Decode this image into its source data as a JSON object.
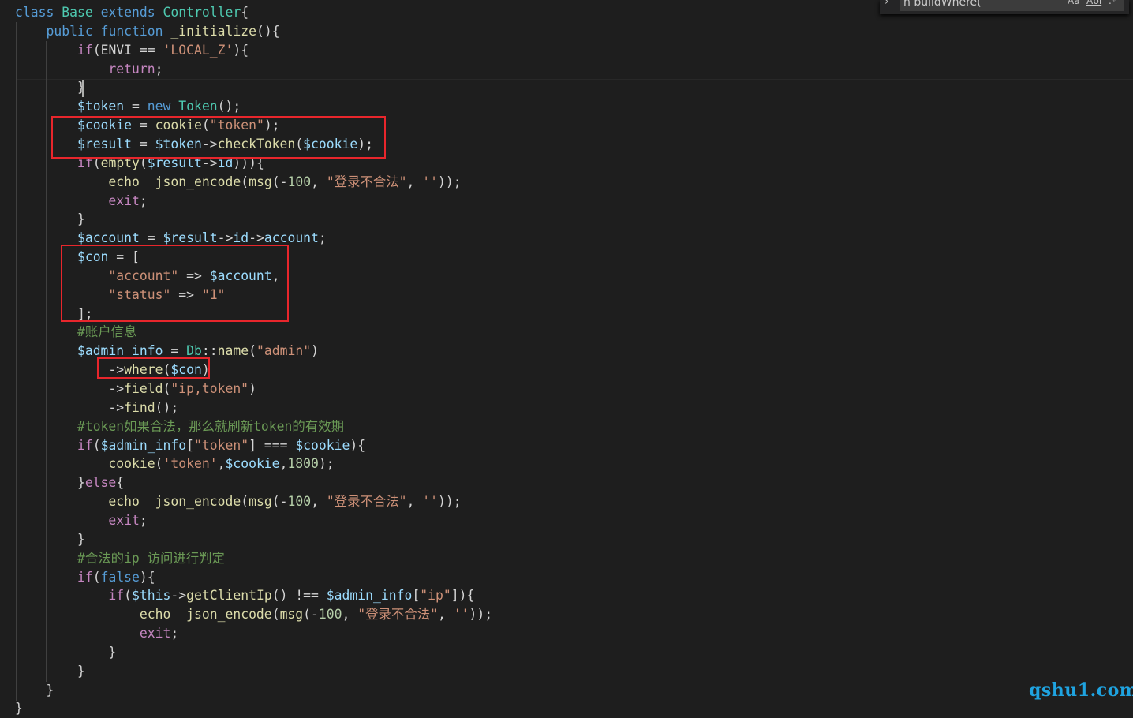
{
  "find_widget": {
    "toggle_icon": "chevron-right-icon",
    "query": "n buildWhere(",
    "match_case_label": "Aa",
    "whole_word_label": "Abl",
    "regex_label": ".*"
  },
  "code": {
    "lines": [
      [
        [
          "kw",
          "class"
        ],
        [
          "pl",
          " "
        ],
        [
          "cls",
          "Base"
        ],
        [
          "pl",
          " "
        ],
        [
          "kw",
          "extends"
        ],
        [
          "pl",
          " "
        ],
        [
          "cls",
          "Controller"
        ],
        [
          "pl",
          "{"
        ]
      ],
      [
        [
          "pl",
          "    "
        ],
        [
          "kw",
          "public"
        ],
        [
          "pl",
          " "
        ],
        [
          "kw",
          "function"
        ],
        [
          "pl",
          " "
        ],
        [
          "fn",
          "_initialize"
        ],
        [
          "pl",
          "(){"
        ]
      ],
      [
        [
          "pl",
          "        "
        ],
        [
          "ctl",
          "if"
        ],
        [
          "pl",
          "(ENVI == "
        ],
        [
          "str",
          "'LOCAL_Z'"
        ],
        [
          "pl",
          "){"
        ]
      ],
      [
        [
          "pl",
          "            "
        ],
        [
          "ctl",
          "return"
        ],
        [
          "pl",
          ";"
        ]
      ],
      [
        [
          "pl",
          "        }"
        ]
      ],
      [
        [
          "pl",
          "        "
        ],
        [
          "var",
          "$token"
        ],
        [
          "pl",
          " = "
        ],
        [
          "kw",
          "new"
        ],
        [
          "pl",
          " "
        ],
        [
          "cls",
          "Token"
        ],
        [
          "pl",
          "();"
        ]
      ],
      [
        [
          "pl",
          "        "
        ],
        [
          "var",
          "$cookie"
        ],
        [
          "pl",
          " = "
        ],
        [
          "fn",
          "cookie"
        ],
        [
          "pl",
          "("
        ],
        [
          "str",
          "\"token\""
        ],
        [
          "pl",
          ");"
        ]
      ],
      [
        [
          "pl",
          "        "
        ],
        [
          "var",
          "$result"
        ],
        [
          "pl",
          " = "
        ],
        [
          "var",
          "$token"
        ],
        [
          "pl",
          "->"
        ],
        [
          "fn",
          "checkToken"
        ],
        [
          "pl",
          "("
        ],
        [
          "var",
          "$cookie"
        ],
        [
          "pl",
          ");"
        ]
      ],
      [
        [
          "pl",
          "        "
        ],
        [
          "ctl",
          "if"
        ],
        [
          "pl",
          "("
        ],
        [
          "fn",
          "empty"
        ],
        [
          "pl",
          "("
        ],
        [
          "var",
          "$result"
        ],
        [
          "pl",
          "->"
        ],
        [
          "var",
          "id"
        ],
        [
          "pl",
          "))){"
        ]
      ],
      [
        [
          "pl",
          "            "
        ],
        [
          "fn",
          "echo"
        ],
        [
          "pl",
          "  "
        ],
        [
          "fn",
          "json_encode"
        ],
        [
          "pl",
          "("
        ],
        [
          "fn",
          "msg"
        ],
        [
          "pl",
          "(-"
        ],
        [
          "num",
          "100"
        ],
        [
          "pl",
          ", "
        ],
        [
          "str",
          "\"登录不合法\""
        ],
        [
          "pl",
          ", "
        ],
        [
          "str",
          "''"
        ],
        [
          "pl",
          "));"
        ]
      ],
      [
        [
          "pl",
          "            "
        ],
        [
          "ctl",
          "exit"
        ],
        [
          "pl",
          ";"
        ]
      ],
      [
        [
          "pl",
          "        }"
        ]
      ],
      [
        [
          "pl",
          "        "
        ],
        [
          "var",
          "$account"
        ],
        [
          "pl",
          " = "
        ],
        [
          "var",
          "$result"
        ],
        [
          "pl",
          "->"
        ],
        [
          "var",
          "id"
        ],
        [
          "pl",
          "->"
        ],
        [
          "var",
          "account"
        ],
        [
          "pl",
          ";"
        ]
      ],
      [
        [
          "pl",
          "        "
        ],
        [
          "var",
          "$con"
        ],
        [
          "pl",
          " = ["
        ]
      ],
      [
        [
          "pl",
          "            "
        ],
        [
          "str",
          "\"account\""
        ],
        [
          "pl",
          " => "
        ],
        [
          "var",
          "$account"
        ],
        [
          "pl",
          ","
        ]
      ],
      [
        [
          "pl",
          "            "
        ],
        [
          "str",
          "\"status\""
        ],
        [
          "pl",
          " => "
        ],
        [
          "str",
          "\"1\""
        ]
      ],
      [
        [
          "pl",
          "        ];"
        ]
      ],
      [
        [
          "pl",
          "        "
        ],
        [
          "cmt",
          "#账户信息"
        ]
      ],
      [
        [
          "pl",
          "        "
        ],
        [
          "var",
          "$admin_info"
        ],
        [
          "pl",
          " = "
        ],
        [
          "cls",
          "Db"
        ],
        [
          "pl",
          "::"
        ],
        [
          "fn",
          "name"
        ],
        [
          "pl",
          "("
        ],
        [
          "str",
          "\"admin\""
        ],
        [
          "pl",
          ")"
        ]
      ],
      [
        [
          "pl",
          "            ->"
        ],
        [
          "fn",
          "where"
        ],
        [
          "pl",
          "("
        ],
        [
          "var",
          "$con"
        ],
        [
          "pl",
          ")"
        ]
      ],
      [
        [
          "pl",
          "            ->"
        ],
        [
          "fn",
          "field"
        ],
        [
          "pl",
          "("
        ],
        [
          "str",
          "\"ip,token\""
        ],
        [
          "pl",
          ")"
        ]
      ],
      [
        [
          "pl",
          "            ->"
        ],
        [
          "fn",
          "find"
        ],
        [
          "pl",
          "();"
        ]
      ],
      [
        [
          "pl",
          "        "
        ],
        [
          "cmt",
          "#token如果合法，那么就刷新token的有效期"
        ]
      ],
      [
        [
          "pl",
          "        "
        ],
        [
          "ctl",
          "if"
        ],
        [
          "pl",
          "("
        ],
        [
          "var",
          "$admin_info"
        ],
        [
          "pl",
          "["
        ],
        [
          "str",
          "\"token\""
        ],
        [
          "pl",
          "] === "
        ],
        [
          "var",
          "$cookie"
        ],
        [
          "pl",
          "){"
        ]
      ],
      [
        [
          "pl",
          "            "
        ],
        [
          "fn",
          "cookie"
        ],
        [
          "pl",
          "("
        ],
        [
          "str",
          "'token'"
        ],
        [
          "pl",
          ","
        ],
        [
          "var",
          "$cookie"
        ],
        [
          "pl",
          ","
        ],
        [
          "num",
          "1800"
        ],
        [
          "pl",
          ");"
        ]
      ],
      [
        [
          "pl",
          "        }"
        ],
        [
          "ctl",
          "else"
        ],
        [
          "pl",
          "{"
        ]
      ],
      [
        [
          "pl",
          "            "
        ],
        [
          "fn",
          "echo"
        ],
        [
          "pl",
          "  "
        ],
        [
          "fn",
          "json_encode"
        ],
        [
          "pl",
          "("
        ],
        [
          "fn",
          "msg"
        ],
        [
          "pl",
          "(-"
        ],
        [
          "num",
          "100"
        ],
        [
          "pl",
          ", "
        ],
        [
          "str",
          "\"登录不合法\""
        ],
        [
          "pl",
          ", "
        ],
        [
          "str",
          "''"
        ],
        [
          "pl",
          "));"
        ]
      ],
      [
        [
          "pl",
          "            "
        ],
        [
          "ctl",
          "exit"
        ],
        [
          "pl",
          ";"
        ]
      ],
      [
        [
          "pl",
          "        }"
        ]
      ],
      [
        [
          "pl",
          "        "
        ],
        [
          "cmt",
          "#合法的ip 访问进行判定"
        ]
      ],
      [
        [
          "pl",
          "        "
        ],
        [
          "ctl",
          "if"
        ],
        [
          "pl",
          "("
        ],
        [
          "kw",
          "false"
        ],
        [
          "pl",
          "){"
        ]
      ],
      [
        [
          "pl",
          "            "
        ],
        [
          "ctl",
          "if"
        ],
        [
          "pl",
          "("
        ],
        [
          "var",
          "$this"
        ],
        [
          "pl",
          "->"
        ],
        [
          "fn",
          "getClientIp"
        ],
        [
          "pl",
          "() !== "
        ],
        [
          "var",
          "$admin_info"
        ],
        [
          "pl",
          "["
        ],
        [
          "str",
          "\"ip\""
        ],
        [
          "pl",
          "]){"
        ]
      ],
      [
        [
          "pl",
          "                "
        ],
        [
          "fn",
          "echo"
        ],
        [
          "pl",
          "  "
        ],
        [
          "fn",
          "json_encode"
        ],
        [
          "pl",
          "("
        ],
        [
          "fn",
          "msg"
        ],
        [
          "pl",
          "(-"
        ],
        [
          "num",
          "100"
        ],
        [
          "pl",
          ", "
        ],
        [
          "str",
          "\"登录不合法\""
        ],
        [
          "pl",
          ", "
        ],
        [
          "str",
          "''"
        ],
        [
          "pl",
          "));"
        ]
      ],
      [
        [
          "pl",
          "                "
        ],
        [
          "ctl",
          "exit"
        ],
        [
          "pl",
          ";"
        ]
      ],
      [
        [
          "pl",
          "            }"
        ]
      ],
      [
        [
          "pl",
          "        }"
        ]
      ],
      [
        [
          "pl",
          "    }"
        ]
      ],
      [
        [
          "pl",
          "}"
        ]
      ]
    ]
  },
  "watermark": "qshu1.com"
}
